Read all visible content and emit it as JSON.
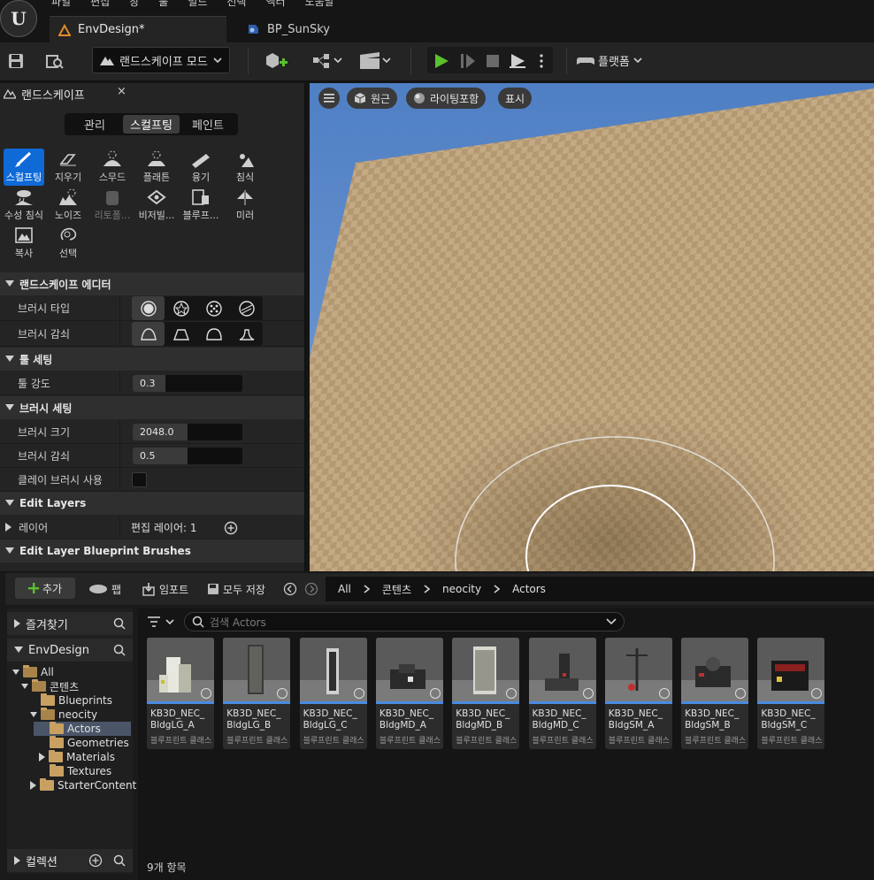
{
  "menu": [
    "파일",
    "편집",
    "창",
    "툴",
    "빌드",
    "선택",
    "액터",
    "도움말"
  ],
  "doc_tabs": [
    {
      "label": "EnvDesign*",
      "active": true
    },
    {
      "label": "BP_SunSky",
      "active": false
    }
  ],
  "toolbar": {
    "mode": "랜드스케이프 모드",
    "platform": "플랫폼"
  },
  "left_panel": {
    "title": "랜드스케이프",
    "close_glyph": "×",
    "mode_tabs": [
      "관리",
      "스컬프팅",
      "페인트"
    ],
    "active_mode": "스컬프팅",
    "tools": [
      {
        "label": "스컬프팅",
        "icon": "brush-icon"
      },
      {
        "label": "지우기",
        "icon": "eraser-icon"
      },
      {
        "label": "스무드",
        "icon": "smooth-icon"
      },
      {
        "label": "플래튼",
        "icon": "flatten-icon"
      },
      {
        "label": "융기",
        "icon": "ramp-icon"
      },
      {
        "label": "침식",
        "icon": "erosion-icon"
      },
      {
        "label": "수성 침식",
        "icon": "hydro-erosion-icon"
      },
      {
        "label": "노이즈",
        "icon": "noise-icon"
      },
      {
        "label": "리토폴...",
        "icon": "retopo-icon"
      },
      {
        "label": "비저빌...",
        "icon": "visibility-icon"
      },
      {
        "label": "블루프...",
        "icon": "blueprint-icon"
      },
      {
        "label": "미러",
        "icon": "mirror-icon"
      },
      {
        "label": "복사",
        "icon": "copy-icon"
      },
      {
        "label": "선택",
        "icon": "select-icon"
      }
    ],
    "sections": {
      "landscape_editor": "랜드스케이프 에디터",
      "tool_settings": "툴 세팅",
      "brush_settings": "브러시 세팅",
      "edit_layers": "Edit Layers",
      "edit_layer_bp": "Edit Layer Blueprint Brushes"
    },
    "rows": {
      "brush_type": "브러시 타입",
      "brush_falloff": "브러시 감쇠",
      "tool_strength": "툴 강도",
      "tool_strength_value": "0.3",
      "tool_strength_fraction": 0.3,
      "brush_size": "브러시 크기",
      "brush_size_value": "2048.0",
      "brush_size_fraction": 0.5,
      "brush_falloff2": "브러시 감쇠",
      "brush_falloff2_value": "0.5",
      "brush_falloff2_fraction": 0.5,
      "clay_brush": "클레이 브러시 사용",
      "layer": "레이어",
      "edit_layer_value": "편집 레이어: 1"
    }
  },
  "viewport": {
    "perspective": "원근",
    "lighting": "라이팅포함",
    "show": "표시"
  },
  "content_browser": {
    "add": "추가",
    "fab": "팹",
    "import": "임포트",
    "save_all": "모두 저장",
    "breadcrumbs": [
      "All",
      "콘텐츠",
      "neocity",
      "Actors"
    ],
    "favorites": "즐겨찾기",
    "project": "EnvDesign",
    "collections": "컬렉션",
    "tree": [
      "All",
      "콘텐츠",
      "Blueprints",
      "neocity",
      "Actors",
      "Geometries",
      "Materials",
      "Textures",
      "StarterContent"
    ],
    "search_placeholder": "검색 Actors",
    "assets": [
      {
        "name1": "KB3D_NEC_",
        "name2": "BldgLG_A",
        "type": "블루프린트 클래스"
      },
      {
        "name1": "KB3D_NEC_",
        "name2": "BldgLG_B",
        "type": "블루프린트 클래스"
      },
      {
        "name1": "KB3D_NEC_",
        "name2": "BldgLG_C",
        "type": "블루프린트 클래스"
      },
      {
        "name1": "KB3D_NEC_",
        "name2": "BldgMD_A",
        "type": "블루프린트 클래스"
      },
      {
        "name1": "KB3D_NEC_",
        "name2": "BldgMD_B",
        "type": "블루프린트 클래스"
      },
      {
        "name1": "KB3D_NEC_",
        "name2": "BldgMD_C",
        "type": "블루프린트 클래스"
      },
      {
        "name1": "KB3D_NEC_",
        "name2": "BldgSM_A",
        "type": "블루프린트 클래스"
      },
      {
        "name1": "KB3D_NEC_",
        "name2": "BldgSM_B",
        "type": "블루프린트 클래스"
      },
      {
        "name1": "KB3D_NEC_",
        "name2": "BldgSM_C",
        "type": "블루프린트 클래스"
      }
    ],
    "item_count": "9개 항목"
  },
  "colors": {
    "accent": "#0f6ad8",
    "play": "#5ac02e",
    "sky": "#5b86c6",
    "ground": "#bfa57f"
  }
}
